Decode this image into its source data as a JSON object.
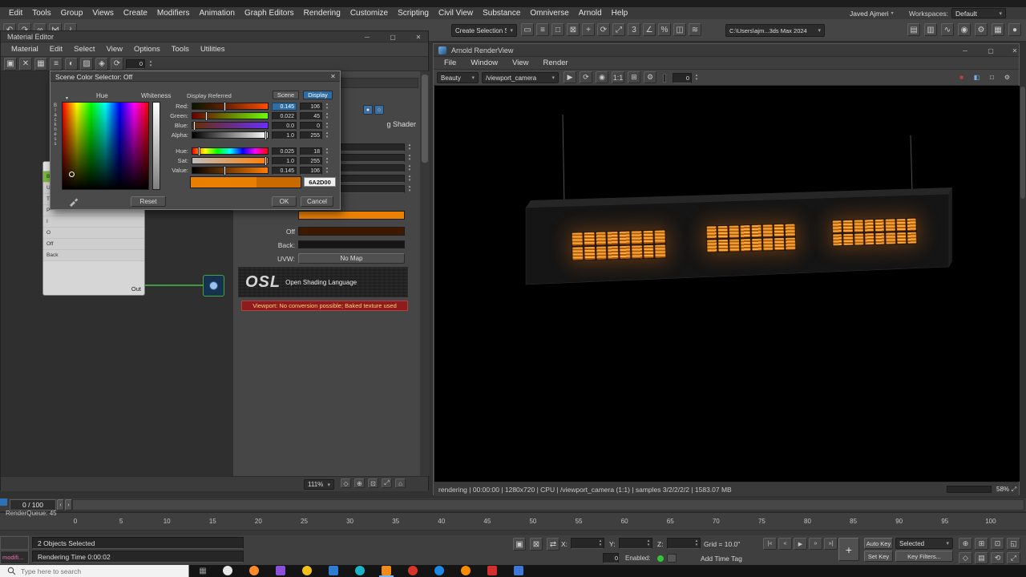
{
  "menubar": {
    "items": [
      "Edit",
      "Tools",
      "Group",
      "Views",
      "Create",
      "Modifiers",
      "Animation",
      "Graph Editors",
      "Rendering",
      "Customize",
      "Scripting",
      "Civil View",
      "Substance",
      "Omniverse",
      "Arnold",
      "Help"
    ]
  },
  "topbar": {
    "user": "Javed Ajmeri",
    "workspaces_label": "Workspaces:",
    "workspace": "Default",
    "selection_set": "Create Selection Se",
    "project_path": "C:\\Users\\ajm...3ds Max 2024",
    "icons_left": [
      {
        "name": "undo-icon",
        "glyph": "↶"
      },
      {
        "name": "redo-icon",
        "glyph": "↷"
      },
      {
        "name": "select-link-icon",
        "glyph": "∞"
      },
      {
        "name": "unlink-icon",
        "glyph": "⋈"
      },
      {
        "name": "bind-to-space-warp-icon",
        "glyph": "≀"
      }
    ],
    "icons_mid": [
      {
        "name": "select-object-icon",
        "glyph": "▭"
      },
      {
        "name": "select-by-name-icon",
        "glyph": "≡"
      },
      {
        "name": "select-region-icon",
        "glyph": "□"
      },
      {
        "name": "window-crossing-icon",
        "glyph": "⊠"
      },
      {
        "name": "select-move-icon",
        "glyph": "+"
      },
      {
        "name": "select-rotate-icon",
        "glyph": "⟳"
      },
      {
        "name": "select-scale-icon",
        "glyph": "⤢"
      },
      {
        "name": "snap-toggle-icon",
        "glyph": "3"
      },
      {
        "name": "angle-snap-icon",
        "glyph": "∠"
      },
      {
        "name": "percent-snap-icon",
        "glyph": "%"
      },
      {
        "name": "mirror-icon",
        "glyph": "◫"
      },
      {
        "name": "align-icon",
        "glyph": "≋"
      }
    ],
    "icons_right": [
      {
        "name": "scene-explorer-icon",
        "glyph": "▤"
      },
      {
        "name": "layer-manager-icon",
        "glyph": "▥"
      },
      {
        "name": "graph-editors-icon",
        "glyph": "∿"
      },
      {
        "name": "material-editor-icon",
        "glyph": "◉"
      },
      {
        "name": "render-setup-icon",
        "glyph": "⚙"
      },
      {
        "name": "rendered-frame-window-icon",
        "glyph": "▦"
      },
      {
        "name": "render-production-icon",
        "glyph": "●"
      }
    ]
  },
  "material_editor": {
    "title": "Material Editor",
    "menus": [
      "Material",
      "Edit",
      "Select",
      "View",
      "Options",
      "Tools",
      "Utilities"
    ],
    "toolbar_icons": [
      {
        "name": "new-node-icon",
        "glyph": "▣"
      },
      {
        "name": "delete-selected-icon",
        "glyph": "✕"
      },
      {
        "name": "layout-all-icon",
        "glyph": "▦"
      },
      {
        "name": "material-list-icon",
        "glyph": "≡"
      },
      {
        "name": "show-shaded-icon",
        "glyph": "◐"
      },
      {
        "name": "show-background-icon",
        "glyph": "▨"
      },
      {
        "name": "validate-icon",
        "glyph": "◈"
      },
      {
        "name": "update-preview-icon",
        "glyph": "⟳"
      }
    ],
    "toolbar_value": "0",
    "node": {
      "slots": [
        "B",
        "U",
        "T",
        "P",
        "I",
        "O",
        "Off",
        "Back"
      ],
      "out_label": "Out"
    },
    "params": {
      "shader_label": "g Shader",
      "off_label": "Off",
      "back_label": "Back:",
      "uvw_label": "UVW:",
      "no_map_label": "No Map",
      "osl_title": "OSL",
      "osl_subtitle": "Open Shading Language",
      "warning": "Viewport: No conversion possible; Baked texture used"
    },
    "renderqueue_label": "RenderQueue: 45",
    "zoom_level": "111%",
    "footer_icons": [
      {
        "name": "pan-hand-icon",
        "glyph": "◇"
      },
      {
        "name": "zoom-icon",
        "glyph": "⊕"
      },
      {
        "name": "zoom-region-icon",
        "glyph": "⊡"
      },
      {
        "name": "zoom-extents-icon",
        "glyph": "⤢"
      },
      {
        "name": "pan-to-selected-icon",
        "glyph": "⌂"
      }
    ]
  },
  "color_selector": {
    "title": "Scene Color Selector: Off",
    "hue_label": "Hue",
    "blackness_label": "Blackness",
    "whiteness_label": "Whiteness",
    "display_referred_label": "Display Referred",
    "scene_tab": "Scene",
    "display_tab": "Display",
    "channels": [
      {
        "label": "Red:",
        "scene": "0.145",
        "display": "106"
      },
      {
        "label": "Green:",
        "scene": "0.022",
        "display": "45"
      },
      {
        "label": "Blue:",
        "scene": "0.0",
        "display": "0"
      },
      {
        "label": "Alpha:",
        "scene": "1.0",
        "display": "255"
      }
    ],
    "hsv": [
      {
        "label": "Hue:",
        "scene": "0.025",
        "display": "18"
      },
      {
        "label": "Sat:",
        "scene": "1.0",
        "display": "255"
      },
      {
        "label": "Value:",
        "scene": "0.145",
        "display": "106"
      }
    ],
    "hex_value": "6A2D00",
    "reset_label": "Reset",
    "ok_label": "OK",
    "cancel_label": "Cancel",
    "current_color": "#e87f00",
    "previous_color": "#c96a00"
  },
  "render_view": {
    "title": "Arnold RenderView",
    "menus": [
      "File",
      "Window",
      "View",
      "Render"
    ],
    "aov": "Beauty",
    "camera": "/viewport_camera",
    "toolbar_icons": [
      {
        "name": "start-render-icon",
        "glyph": "▶"
      },
      {
        "name": "refresh-render-icon",
        "glyph": "⟳"
      },
      {
        "name": "snapshot-icon",
        "glyph": "◉"
      },
      {
        "name": "zoom-1-1-icon",
        "glyph": "1:1"
      },
      {
        "name": "region-render-icon",
        "glyph": "⊞"
      },
      {
        "name": "render-settings-icon",
        "glyph": "⚙"
      }
    ],
    "exposure_value": "0",
    "right_icons": [
      {
        "name": "abort-render-icon",
        "glyph": "■",
        "color": "#c24040"
      },
      {
        "name": "rgb-display-icon",
        "glyph": "◧",
        "color": "#7ab0e0"
      },
      {
        "name": "alpha-display-icon",
        "glyph": "□",
        "color": "#e0e0e0"
      },
      {
        "name": "display-settings-icon",
        "glyph": "⚙",
        "color": "#c8c8c8"
      }
    ],
    "status": "rendering | 00:00:00 | 1280x720 | CPU | /viewport_camera (1:1) | samples 3/2/2/2/2 | 1583.07 MB",
    "progress_label": "58%",
    "progress_value": 58
  },
  "timeline": {
    "frame_display": "0 / 100",
    "prev_label": "‹",
    "next_label": "›",
    "ticks": [
      "0",
      "5",
      "10",
      "15",
      "20",
      "25",
      "30",
      "35",
      "40",
      "45",
      "50",
      "55",
      "60",
      "65",
      "70",
      "75",
      "80",
      "85",
      "90",
      "95",
      "100"
    ]
  },
  "status_bar": {
    "listener_text": "modifi...",
    "selection_status": "2 Objects Selected",
    "render_time": "Rendering Time 0:00:02",
    "mid_icons": [
      {
        "name": "isolate-selection-icon",
        "glyph": "▣"
      },
      {
        "name": "selection-lock-icon",
        "glyph": "⊠"
      },
      {
        "name": "absolute-relative-mode-icon",
        "glyph": "⇄"
      }
    ],
    "coord_labels": {
      "x": "X:",
      "y": "Y:",
      "z": "Z:"
    },
    "grid_label": "Grid = 10.0\"",
    "time_tag_spinner": "0",
    "enabled_label": "Enabled:",
    "add_time_tag": "Add Time Tag",
    "playback_icons": [
      {
        "name": "go-to-start-icon",
        "glyph": "|«"
      },
      {
        "name": "previous-frame-icon",
        "glyph": "«"
      },
      {
        "name": "play-icon",
        "glyph": "▶"
      },
      {
        "name": "next-frame-icon",
        "glyph": "»"
      },
      {
        "name": "go-to-end-icon",
        "glyph": "»|"
      }
    ],
    "set_keys_glyph": "+",
    "auto_key": "Auto Key",
    "key_mode": "Selected",
    "set_key": "Set Key",
    "key_filters": "Key Filters...",
    "nav_icons": [
      {
        "name": "zoom-icon",
        "glyph": "⊕"
      },
      {
        "name": "zoom-all-icon",
        "glyph": "⊞"
      },
      {
        "name": "zoom-extents-icon",
        "glyph": "⊡"
      },
      {
        "name": "zoom-region-icon",
        "glyph": "◱"
      },
      {
        "name": "field-of-view-icon",
        "glyph": "◇"
      },
      {
        "name": "pan-icon",
        "glyph": "▤"
      },
      {
        "name": "orbit-icon",
        "glyph": "⟲"
      },
      {
        "name": "maximize-viewport-icon",
        "glyph": "⤢"
      }
    ]
  },
  "window_icons": {
    "minimize": "─",
    "maximize": "▢",
    "close": "✕"
  },
  "taskbar": {
    "search_placeholder": "Type here to search",
    "task_view_glyph": "▦",
    "apps": [
      {
        "name": "taskbar-app-icon",
        "color": "#e8e8e8",
        "shape": "circle"
      },
      {
        "name": "taskbar-app-icon",
        "color": "#ff8a2a",
        "shape": "circle"
      },
      {
        "name": "taskbar-app-icon",
        "color": "#8a4fd8",
        "shape": "square"
      },
      {
        "name": "taskbar-app-icon",
        "color": "#f3c21a",
        "shape": "circle"
      },
      {
        "name": "taskbar-app-icon",
        "color": "#2d7dd2",
        "shape": "square"
      },
      {
        "name": "taskbar-app-icon",
        "color": "#19b5c8",
        "shape": "circle"
      },
      {
        "name": "taskbar-app-icon",
        "color": "#f08c1b",
        "shape": "square",
        "active": "true"
      },
      {
        "name": "taskbar-app-icon",
        "color": "#d8352a",
        "shape": "circle"
      },
      {
        "name": "taskbar-app-icon",
        "color": "#1e88e5",
        "shape": "circle"
      },
      {
        "name": "taskbar-app-icon",
        "color": "#fb8c00",
        "shape": "circle"
      },
      {
        "name": "taskbar-app-icon",
        "color": "#d32f2f",
        "shape": "square"
      },
      {
        "name": "taskbar-app-icon",
        "color": "#3b78d8",
        "shape": "square"
      }
    ]
  }
}
